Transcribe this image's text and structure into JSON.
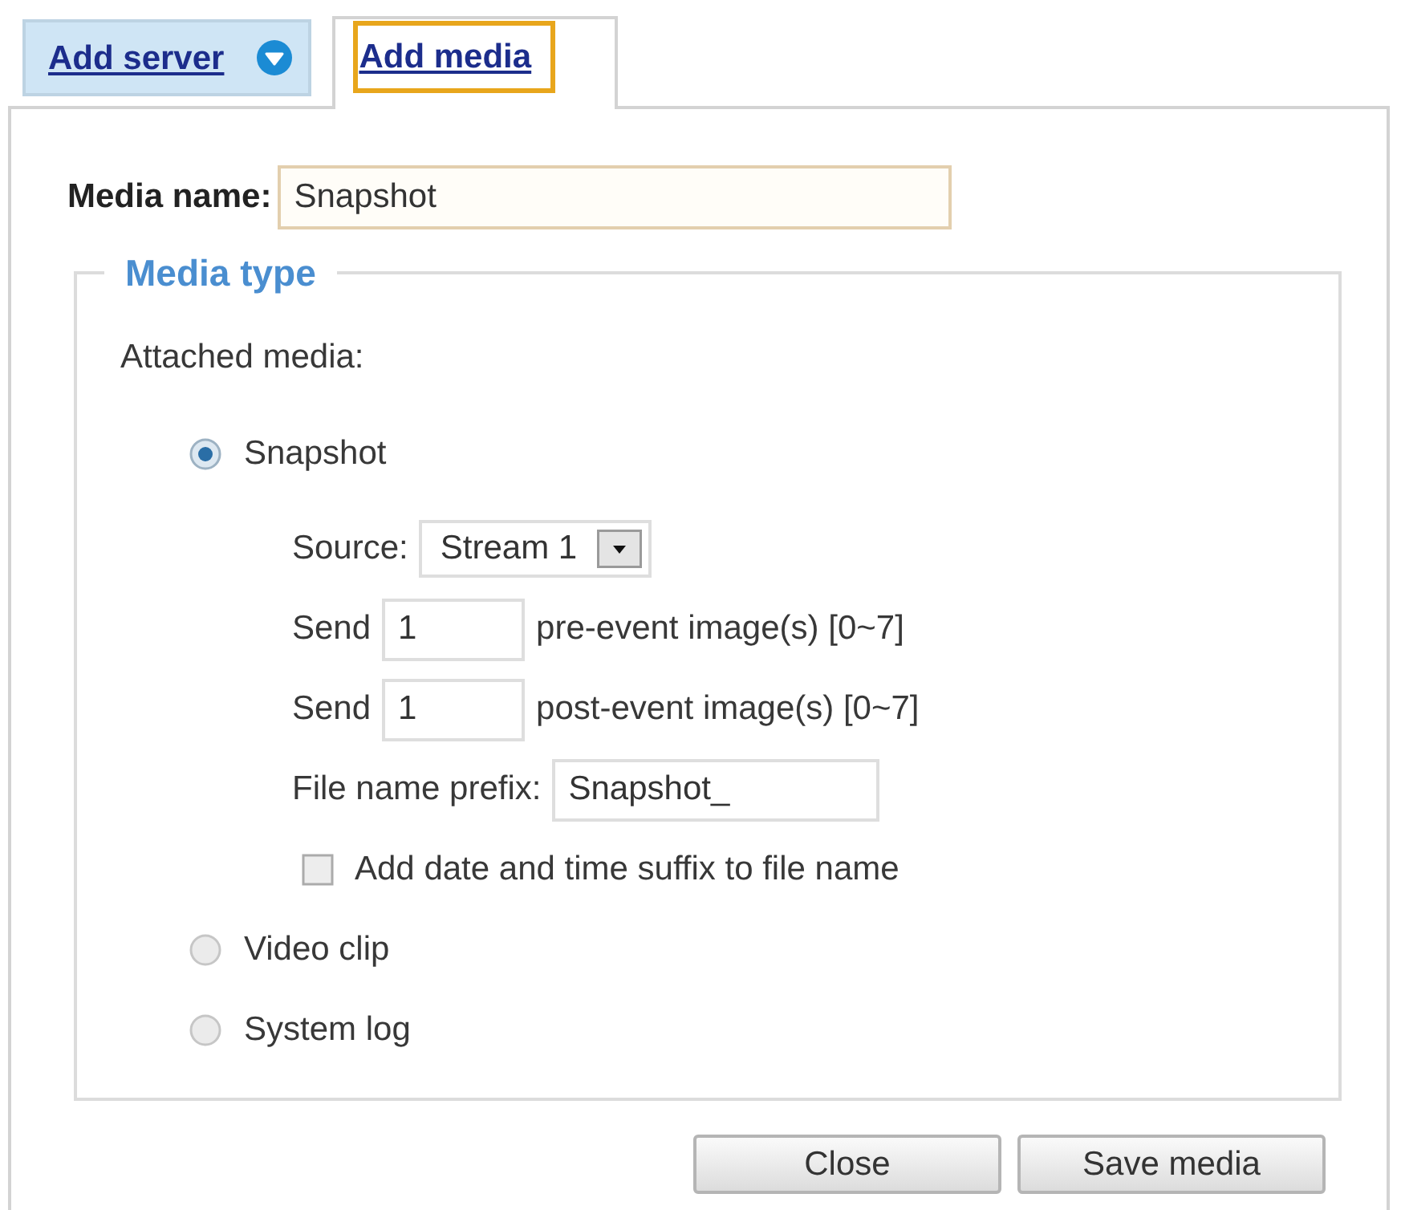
{
  "tabs": [
    {
      "label": "Add server",
      "kind": "menu",
      "selected": false,
      "highlighted": false
    },
    {
      "label": "Add media",
      "kind": "plain",
      "selected": true,
      "highlighted": true
    }
  ],
  "media_name": {
    "label": "Media name:",
    "value": "Snapshot"
  },
  "media_type": {
    "legend": "Media type",
    "label": "Attached media:",
    "options": [
      {
        "label": "Snapshot",
        "selected": true,
        "fields": [
          {
            "kind": "select",
            "label": "Source:",
            "value": "Stream 1"
          },
          {
            "kind": "count",
            "label": "Send",
            "value": "1",
            "hint": "pre-event image(s) [0~7]"
          },
          {
            "kind": "count",
            "label": "Send",
            "value": "1",
            "hint": "post-event image(s) [0~7]"
          },
          {
            "kind": "text",
            "label": "File name prefix:",
            "value": "Snapshot_"
          },
          {
            "kind": "checkbox",
            "label": "Add date and time suffix to file name",
            "checked": false
          }
        ]
      },
      {
        "label": "Video clip",
        "selected": false
      },
      {
        "label": "System log",
        "selected": false
      }
    ]
  },
  "buttons": [
    {
      "label": "Close"
    },
    {
      "label": "Save media"
    }
  ]
}
